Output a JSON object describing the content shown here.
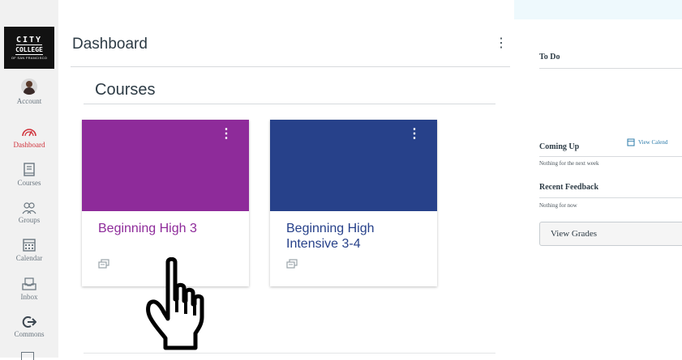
{
  "logo": {
    "line1": "CITY",
    "line2": "COLLEGE",
    "line3": "OF SAN FRANCISCO"
  },
  "nav": {
    "items": [
      {
        "label": "Account",
        "icon": "avatar"
      },
      {
        "label": "Dashboard",
        "icon": "dashboard-icon",
        "active": true
      },
      {
        "label": "Courses",
        "icon": "courses-icon"
      },
      {
        "label": "Groups",
        "icon": "groups-icon"
      },
      {
        "label": "Calendar",
        "icon": "calendar-icon"
      },
      {
        "label": "Inbox",
        "icon": "inbox-icon"
      },
      {
        "label": "Commons",
        "icon": "commons-icon"
      }
    ],
    "active_color": "#d0313a"
  },
  "header": {
    "title": "Dashboard",
    "menu_icon": "more-vertical-icon"
  },
  "courses": {
    "heading": "Courses",
    "cards": [
      {
        "name": "Beginning High 3",
        "color": "#8e2b9a",
        "text_color": "#8e2b9a",
        "menu_icon": "more-vertical-icon",
        "footer_icon": "announcements-icon"
      },
      {
        "name": "Beginning High Intensive 3-4",
        "color": "#27418a",
        "text_color": "#27418a",
        "menu_icon": "more-vertical-icon",
        "footer_icon": "announcements-icon"
      }
    ]
  },
  "sidebar": {
    "todo_title": "To Do",
    "coming_up_title": "Coming Up",
    "view_calendar_label": "View Calend",
    "coming_up_empty": "Nothing for the next week",
    "recent_feedback_title": "Recent Feedback",
    "recent_feedback_empty": "Nothing for now",
    "view_grades_label": "View Grades"
  },
  "cursor_icon": "hand-pointer-icon"
}
